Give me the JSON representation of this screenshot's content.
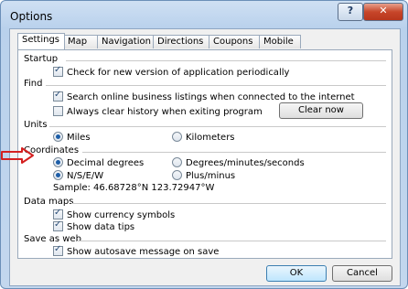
{
  "window": {
    "title": "Options",
    "help_glyph": "?",
    "close_glyph": "✕"
  },
  "tabs": [
    "Settings",
    "Map",
    "Navigation",
    "Directions",
    "Coupons",
    "Mobile"
  ],
  "startup": {
    "heading": "Startup",
    "check_version": {
      "label": "Check for new version of application periodically",
      "checked": true
    }
  },
  "find": {
    "heading": "Find",
    "search_online": {
      "label": "Search online business listings when connected to the internet",
      "checked": true
    },
    "clear_history": {
      "label": "Always clear history when exiting program",
      "checked": false
    },
    "clear_button": "Clear now"
  },
  "units": {
    "heading": "Units",
    "miles": {
      "label": "Miles",
      "selected": true
    },
    "kilometers": {
      "label": "Kilometers",
      "selected": false
    }
  },
  "coordinates": {
    "heading": "Coordinates",
    "decimal_degrees": {
      "label": "Decimal degrees",
      "selected": true
    },
    "dms": {
      "label": "Degrees/minutes/seconds",
      "selected": false
    },
    "nsew": {
      "label": "N/S/E/W",
      "selected": true
    },
    "plus_minus": {
      "label": "Plus/minus",
      "selected": false
    },
    "sample": "Sample: 46.68728°N 123.72947°W",
    "annotation_color": "#d42020"
  },
  "data_maps": {
    "heading": "Data maps",
    "currency": {
      "label": "Show currency symbols",
      "checked": true
    },
    "data_tips": {
      "label": "Show data tips",
      "checked": true
    }
  },
  "save_as_web": {
    "heading": "Save as web",
    "autosave": {
      "label": "Show autosave message on save",
      "checked": true
    }
  },
  "footer": {
    "ok": "OK",
    "cancel": "Cancel"
  }
}
